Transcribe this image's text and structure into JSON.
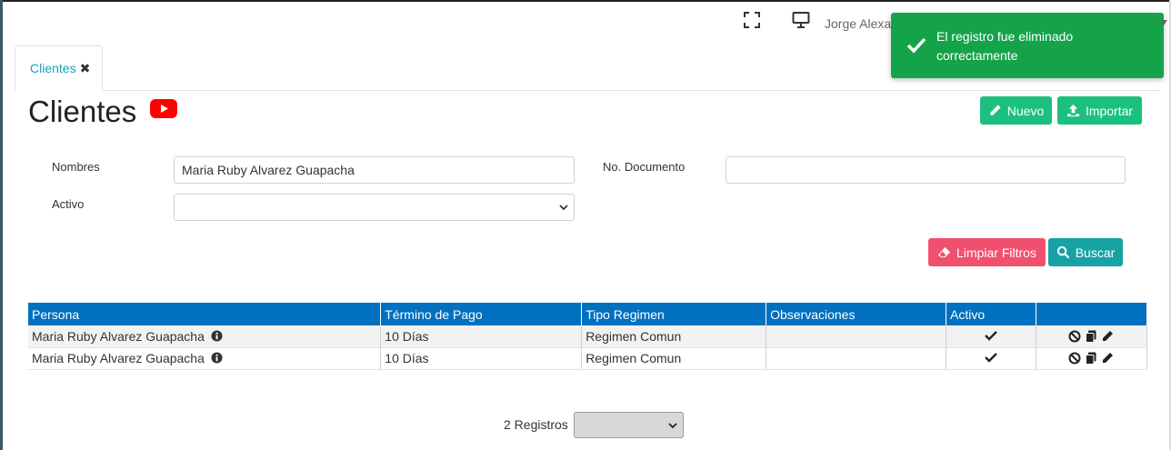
{
  "header": {
    "user_name": "Jorge Alexa"
  },
  "tabs": [
    {
      "label": "Clientes"
    }
  ],
  "page": {
    "title": "Clientes"
  },
  "toolbar": {
    "new_label": "Nuevo",
    "import_label": "Importar"
  },
  "filters": {
    "nombres_label": "Nombres",
    "nombres_value": "Maria Ruby Alvarez Guapacha",
    "documento_label": "No. Documento",
    "documento_value": "",
    "activo_label": "Activo",
    "activo_value": "",
    "clear_label": "Limpiar Filtros",
    "search_label": "Buscar"
  },
  "table": {
    "columns": [
      "Persona",
      "Término de Pago",
      "Tipo Regimen",
      "Observaciones",
      "Activo",
      ""
    ],
    "rows": [
      {
        "persona": "Maria Ruby Alvarez Guapacha",
        "termino": "10 Días",
        "regimen": "Regimen Comun",
        "observaciones": ""
      },
      {
        "persona": "Maria Ruby Alvarez Guapacha",
        "termino": "10 Días",
        "regimen": "Regimen Comun",
        "observaciones": ""
      }
    ]
  },
  "pager": {
    "count_text": "2 Registros"
  },
  "toast": {
    "message": "El registro fue eliminado correctamente"
  },
  "colors": {
    "accent": "#1bc07f",
    "header_blue": "#0070c0",
    "danger": "#f0506e",
    "teal": "#17a2a4",
    "toast_green": "#15a34a"
  }
}
